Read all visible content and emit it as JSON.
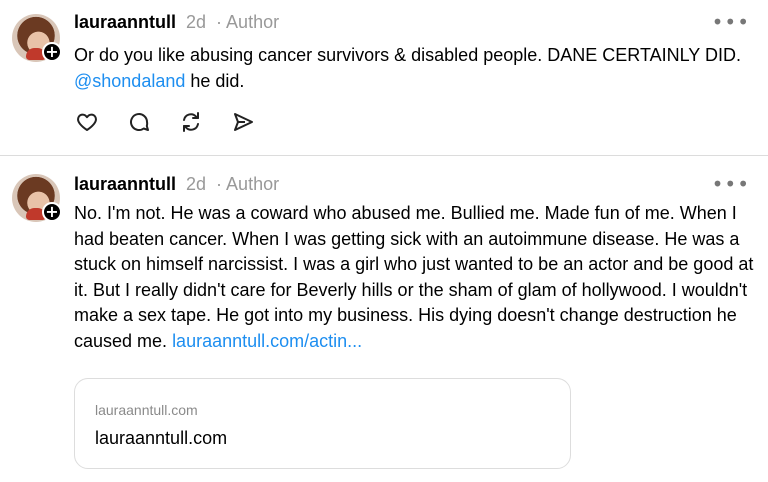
{
  "posts": [
    {
      "username": "lauraanntull",
      "time": "2d",
      "author_tag": "· Author",
      "more": "•••",
      "text_main": "Or do you like abusing cancer survivors & disabled people. DANE CERTAINLY DID.",
      "mention": "@shondaland",
      "text_after": " he did.",
      "actions": [
        "heart-icon",
        "comment-icon",
        "repost-icon",
        "share-icon"
      ]
    },
    {
      "username": "lauraanntull",
      "time": "2d",
      "author_tag": "· Author",
      "more": "•••",
      "text_main": "No. I'm not. He was a coward who abused me. Bullied me. Made fun of me. When I had beaten cancer. When I was getting sick with an autoimmune disease. He was a stuck on himself narcissist. I was a girl who just wanted to be an actor and be good at it. But I really didn't care for Beverly hills or the sham of glam of hollywood. I wouldn't make a sex tape. He got into my business. His dying doesn't change destruction he caused me. ",
      "link": "lauraanntull.com/actin...",
      "link_card": {
        "domain": "lauraanntull.com",
        "title": "lauraanntull.com"
      }
    }
  ],
  "colors": {
    "link": "#1d8ef0",
    "muted": "#999999",
    "divider": "#dcdcdc"
  }
}
